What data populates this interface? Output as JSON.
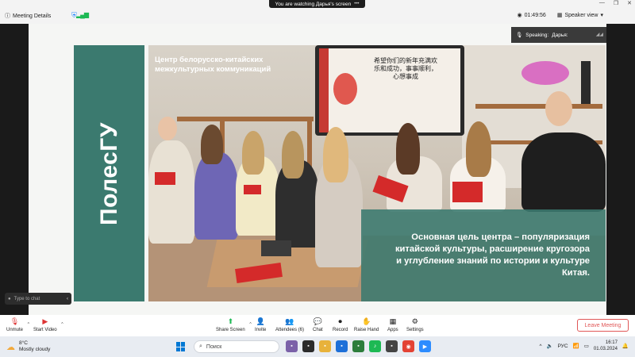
{
  "titlebar": {
    "meeting_details": "Meeting Details",
    "sharing_banner": "You are watching Дарья's screen",
    "timer": "01:49:56",
    "view": "Speaker view"
  },
  "speaker": {
    "label": "Speaking:",
    "name": "Дарья:"
  },
  "slide": {
    "brand": "ПолесГУ",
    "caption_lines": [
      "Центр белорусско-китайских",
      "межкультурных коммуникаций"
    ],
    "goal_lines": [
      "Основная цель центра – популяризация",
      "китайской культуры, расширение кругозора",
      "и углубление знаний по истории и культуре",
      "Китая."
    ],
    "screen_text_lines": [
      "希望你们的新年充满欢",
      "乐和成功，事事顺利，",
      "心想事成"
    ],
    "colors": {
      "brand": "#3b7a6f",
      "accent_red": "#d42a2a"
    }
  },
  "chat": {
    "placeholder": "Type to chat"
  },
  "toolbar": {
    "unmute": "Unmute",
    "start_video": "Start Video",
    "share_screen": "Share Screen",
    "invite": "Invite",
    "attendees": "Attendees (6)",
    "chat": "Chat",
    "record": "Record",
    "raise_hand": "Raise Hand",
    "apps": "Apps",
    "settings": "Settings",
    "leave": "Leave Meeting"
  },
  "taskbar": {
    "temp": "8°C",
    "weather": "Mostly cloudy",
    "search": "Поиск",
    "lang": "РУС",
    "time": "16:17",
    "date": "01.03.2024"
  }
}
